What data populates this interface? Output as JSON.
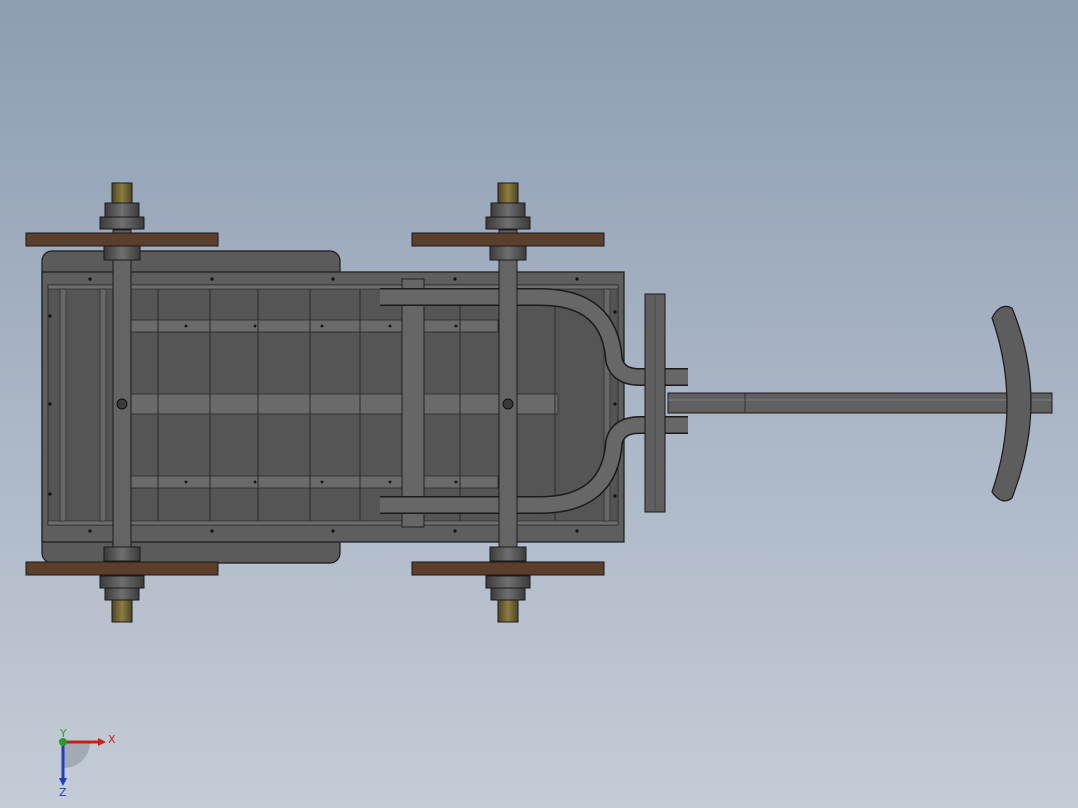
{
  "viewport": {
    "background_top": "#8d9db2",
    "background_bottom": "#c4ccd6"
  },
  "model": {
    "name": "cart-assembly",
    "view": "top",
    "colors": {
      "frame": "#5f5f5f",
      "frame_dark": "#3c3c3c",
      "frame_light": "#7a7a7a",
      "wheel_board": "#5a3f2c",
      "hub_brass": "#6e6233",
      "edge": "#1a1a1a"
    }
  },
  "triad": {
    "x_label": "X",
    "y_label": "Y",
    "z_label": "Z",
    "x_color": "#c81e1e",
    "y_color": "#22a022",
    "z_color": "#1f3fbf"
  }
}
